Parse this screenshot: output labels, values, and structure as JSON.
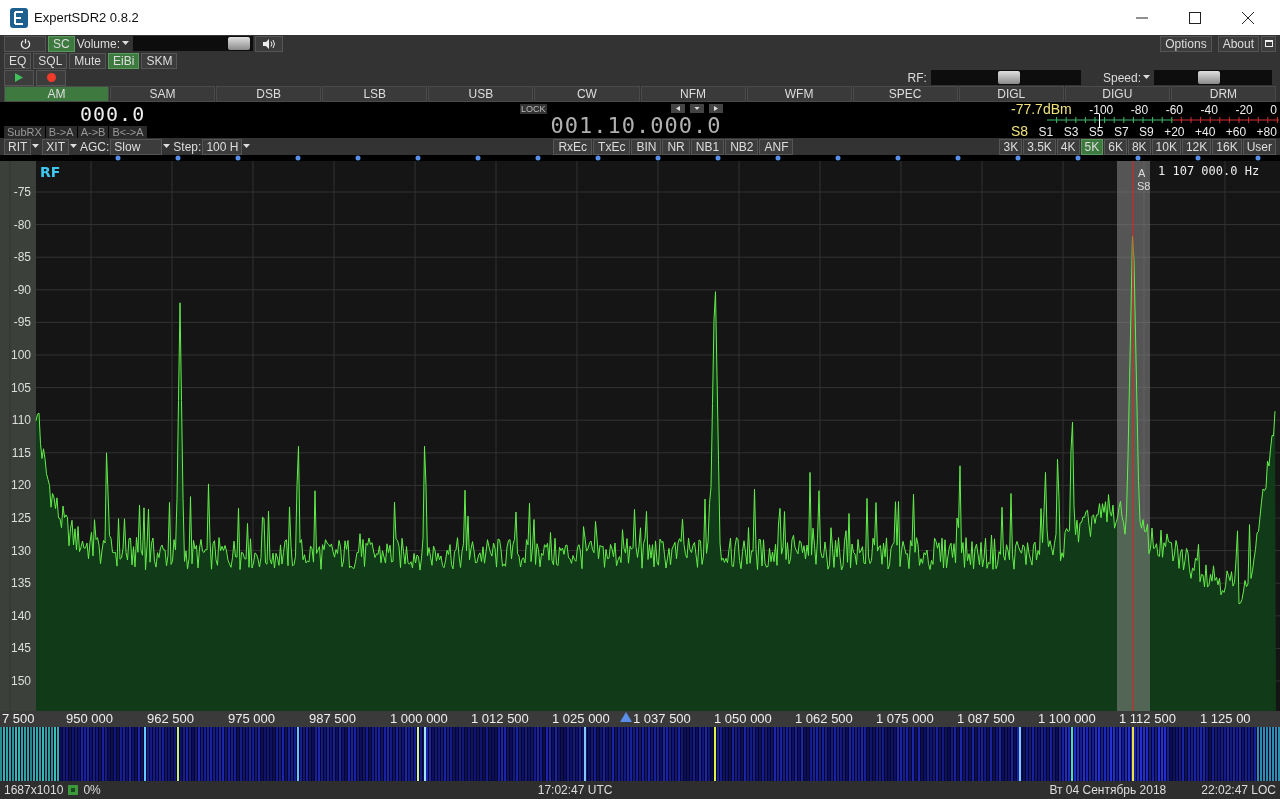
{
  "window": {
    "title": "ExpertSDR2 0.8.2"
  },
  "top_buttons": [
    {
      "label": "SC",
      "selected": true
    }
  ],
  "volume": {
    "label": "Volume:",
    "level": 0.88
  },
  "menu_buttons": [
    "Options",
    "About"
  ],
  "toggles": [
    {
      "label": "EQ",
      "on": false
    },
    {
      "label": "SQL",
      "on": false
    },
    {
      "label": "Mute",
      "on": false
    },
    {
      "label": "EiBi",
      "on": true
    },
    {
      "label": "SKM",
      "on": false
    }
  ],
  "rf": {
    "label": "RF:",
    "level": 0.52
  },
  "speed": {
    "label": "Speed:",
    "level": 0.47
  },
  "modes": [
    {
      "label": "AM",
      "selected": true
    },
    {
      "label": "SAM",
      "selected": false
    },
    {
      "label": "DSB",
      "selected": false
    },
    {
      "label": "LSB",
      "selected": false
    },
    {
      "label": "USB",
      "selected": false
    },
    {
      "label": "CW",
      "selected": false
    },
    {
      "label": "NFM",
      "selected": false
    },
    {
      "label": "WFM",
      "selected": false
    },
    {
      "label": "SPEC",
      "selected": false
    },
    {
      "label": "DIGL",
      "selected": false
    },
    {
      "label": "DIGU",
      "selected": false
    },
    {
      "label": "DRM",
      "selected": false
    }
  ],
  "sub_display": {
    "frequency": "000.0",
    "buttons": [
      "SubRX",
      "B->A",
      "A->B",
      "B<->A"
    ]
  },
  "main_display": {
    "lock": "LOCK",
    "frequency": "001.10.000.0"
  },
  "s_meter": {
    "reading": "-77.7dBm",
    "s_reading": "S8",
    "dbm_scale": [
      "-100",
      "-80",
      "-60",
      "-40",
      "-20",
      "0"
    ],
    "s_scale": [
      "S1",
      "S3",
      "S5",
      "S7",
      "S9",
      "+20",
      "+40",
      "+60",
      "+80"
    ],
    "level": 0.33
  },
  "controls": {
    "rit": "RIT",
    "xit": "XIT",
    "agc_label": "AGC:",
    "agc": "Slow",
    "step_label": "Step:",
    "step": "100 H"
  },
  "dsp_buttons": [
    "RxEc",
    "TxEc",
    "BIN",
    "NR",
    "NB1",
    "NB2",
    "ANF"
  ],
  "filters": [
    {
      "label": "3K",
      "selected": false
    },
    {
      "label": "3.5K",
      "selected": false
    },
    {
      "label": "4K",
      "selected": false
    },
    {
      "label": "5K",
      "selected": true
    },
    {
      "label": "6K",
      "selected": false
    },
    {
      "label": "8K",
      "selected": false
    },
    {
      "label": "10K",
      "selected": false
    },
    {
      "label": "12K",
      "selected": false
    },
    {
      "label": "16K",
      "selected": false
    },
    {
      "label": "User",
      "selected": false
    }
  ],
  "spectrum": {
    "label": "RF",
    "y_labels": [
      "-75",
      "-80",
      "-85",
      "-90",
      "-95",
      "100",
      "105",
      "110",
      "115",
      "120",
      "125",
      "130",
      "135",
      "140",
      "145",
      "150"
    ],
    "x_labels": [
      "7 500",
      "950 000",
      "962 500",
      "975 000",
      "987 500",
      "1 000 000",
      "1 012 500",
      "1 025 000",
      "1 037 500",
      "1 050 000",
      "1 062 500",
      "1 075 000",
      "1 087 500",
      "1 100 000",
      "1 112 500",
      "1 125 00"
    ],
    "marker": {
      "channel": "A",
      "s_reading": "S8",
      "frequency": "1 107 000.0 Hz"
    }
  },
  "status_bar": {
    "resolution": "1687x1010",
    "load": "0%",
    "utc": "17:02:47 UTC",
    "date": "Вт 04 Сентябрь 2018",
    "local": "22:02:47 LOC"
  }
}
